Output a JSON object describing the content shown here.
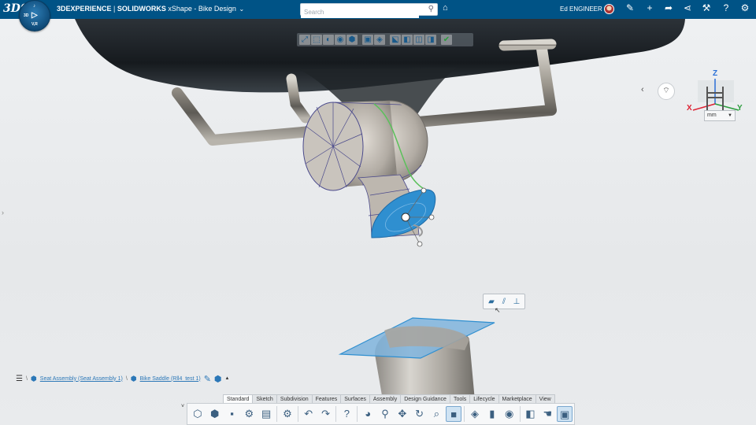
{
  "topbar": {
    "logo": "3DS",
    "compass": {
      "play": "▷",
      "top": "♪",
      "left": "3D",
      "bottom": "V,R"
    },
    "title_brand": "3DEXPERIENCE",
    "title_sep": " | ",
    "title_product": "SOLIDWORKS",
    "title_rest": " xShape - Bike Design",
    "search": {
      "placeholder": "Search",
      "value": ""
    },
    "user_name": "Ed ENGINEER",
    "icons": [
      "tag-icon",
      "share-post-icon",
      "add-icon",
      "forward-icon",
      "share-icon",
      "tools-icon",
      "help-icon",
      "compass-toggle-icon"
    ]
  },
  "viewport": {
    "triad_labels": {
      "z": "Z",
      "x": "X",
      "y": "Y"
    },
    "units_value": "mm",
    "collapse": "‹"
  },
  "breadcrumb": {
    "menu": "☰",
    "items": [
      {
        "label": "Seat Assembly (Seat Assembly 1)"
      },
      {
        "label": "Bike Saddle (Rll4_test 1)"
      }
    ]
  },
  "toolbar": {
    "tabs": [
      "Standard",
      "Sketch",
      "Subdivision",
      "Features",
      "Surfaces",
      "Assembly",
      "Design Guidance",
      "Tools",
      "Lifecycle",
      "Marketplace",
      "View"
    ],
    "active_tab": "Standard",
    "collapse": "˅",
    "selected_icon": "display-style-icon"
  },
  "colors": {
    "topbar": "#005386",
    "selection": "#2f8fd0",
    "viewport": "#e9ebed",
    "accent": "#2b77b7"
  }
}
